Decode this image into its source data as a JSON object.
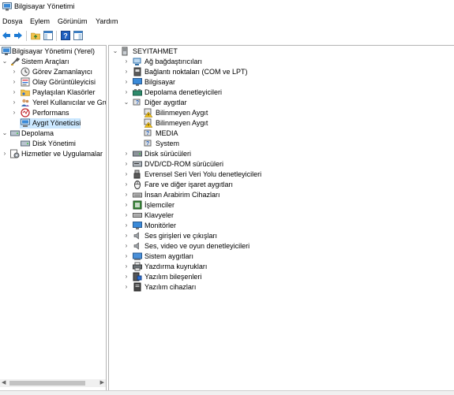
{
  "window": {
    "title": "Bilgisayar Yönetimi"
  },
  "menu": [
    "Dosya",
    "Eylem",
    "Görünüm",
    "Yardım"
  ],
  "toolbar": {
    "buttons": [
      "back-arrow-icon",
      "forward-arrow-icon",
      "up-folder-icon",
      "show-hide-tree-icon",
      "help-icon",
      "view-icon"
    ]
  },
  "left_tree": [
    {
      "label": "Bilgisayar Yönetimi (Yerel)",
      "icon": "computer-management-icon"
    },
    {
      "label": "Sistem Araçları",
      "icon": "tools-icon",
      "expanded": true
    },
    {
      "label": "Görev Zamanlayıcı",
      "icon": "clock-icon"
    },
    {
      "label": "Olay Görüntüleyicisi",
      "icon": "event-viewer-icon"
    },
    {
      "label": "Paylaşılan Klasörler",
      "icon": "shared-folder-icon"
    },
    {
      "label": "Yerel Kullanıcılar ve Gru",
      "icon": "users-icon"
    },
    {
      "label": "Performans",
      "icon": "performance-icon"
    },
    {
      "label": "Aygıt Yöneticisi",
      "icon": "device-manager-icon",
      "selected": true
    },
    {
      "label": "Depolama",
      "icon": "storage-icon",
      "expanded": true
    },
    {
      "label": "Disk Yönetimi",
      "icon": "disk-icon"
    },
    {
      "label": "Hizmetler ve Uygulamalar",
      "icon": "services-icon"
    }
  ],
  "device_tree": {
    "root": "SEYITAHMET",
    "categories": [
      {
        "label": "Ağ bağdaştırıcıları",
        "icon": "network-adapter-icon"
      },
      {
        "label": "Bağlantı noktaları (COM ve LPT)",
        "icon": "port-icon"
      },
      {
        "label": "Bilgisayar",
        "icon": "monitor-icon"
      },
      {
        "label": "Depolama denetleyicileri",
        "icon": "storage-controller-icon"
      },
      {
        "label": "Diğer aygıtlar",
        "icon": "other-devices-icon",
        "expanded": true
      },
      {
        "label": "Bilinmeyen Aygıt",
        "icon": "unknown-device-warning-icon",
        "child": true
      },
      {
        "label": "Bilinmeyen Aygıt",
        "icon": "unknown-device-warning-icon",
        "child": true
      },
      {
        "label": "MEDIA",
        "icon": "unknown-device-icon",
        "child": true
      },
      {
        "label": "System",
        "icon": "unknown-device-icon",
        "child": true
      },
      {
        "label": "Disk sürücüleri",
        "icon": "disk-drive-icon"
      },
      {
        "label": "DVD/CD-ROM sürücüleri",
        "icon": "dvd-icon"
      },
      {
        "label": "Evrensel Seri Veri Yolu denetleyicileri",
        "icon": "usb-icon"
      },
      {
        "label": "Fare ve diğer işaret aygıtları",
        "icon": "mouse-icon"
      },
      {
        "label": "İnsan Arabirim Cihazları",
        "icon": "hid-icon"
      },
      {
        "label": "İşlemciler",
        "icon": "processor-icon"
      },
      {
        "label": "Klavyeler",
        "icon": "keyboard-icon"
      },
      {
        "label": "Monitörler",
        "icon": "monitor-icon"
      },
      {
        "label": "Ses girişleri ve çıkışları",
        "icon": "speaker-icon"
      },
      {
        "label": "Ses, video ve oyun denetleyicileri",
        "icon": "speaker-icon"
      },
      {
        "label": "Sistem aygıtları",
        "icon": "system-devices-icon"
      },
      {
        "label": "Yazdırma kuyrukları",
        "icon": "printer-icon"
      },
      {
        "label": "Yazılım bileşenleri",
        "icon": "software-component-icon"
      },
      {
        "label": "Yazılım cihazları",
        "icon": "software-device-icon"
      }
    ]
  }
}
